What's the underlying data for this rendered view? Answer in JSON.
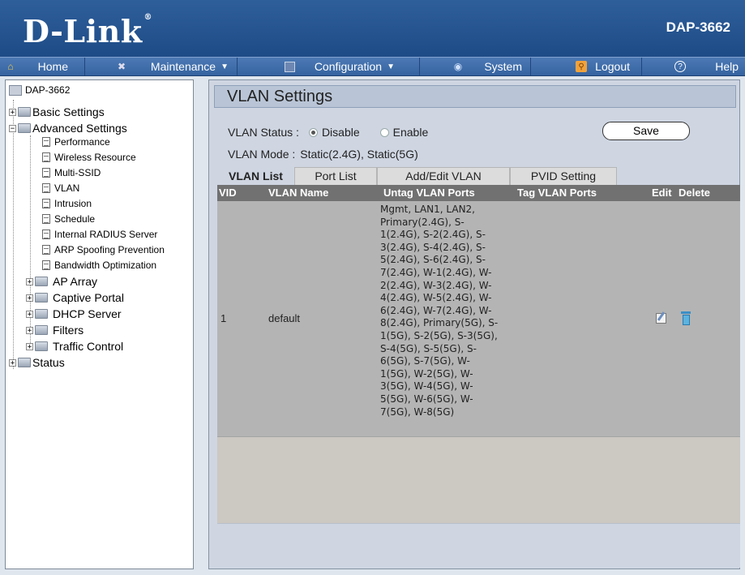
{
  "header": {
    "brand": "D-Link",
    "model": "DAP-3662"
  },
  "menu": [
    {
      "label": "Home",
      "icon": "home-icon",
      "caret": false
    },
    {
      "label": "Maintenance",
      "icon": "tools-icon",
      "caret": true
    },
    {
      "label": "Configuration",
      "icon": "floppy-icon",
      "caret": true
    },
    {
      "label": "System",
      "icon": "system-icon",
      "caret": false
    },
    {
      "label": "Logout",
      "icon": "key-icon",
      "caret": false
    },
    {
      "label": "Help",
      "icon": "help-icon",
      "caret": false
    }
  ],
  "tree": {
    "root": "DAP-3662",
    "items": [
      "Basic Settings",
      "Advanced Settings",
      "Performance",
      "Wireless Resource",
      "Multi-SSID",
      "VLAN",
      "Intrusion",
      "Schedule",
      "Internal RADIUS Server",
      "ARP Spoofing Prevention",
      "Bandwidth Optimization",
      "AP Array",
      "Captive Portal",
      "DHCP Server",
      "Filters",
      "Traffic Control",
      "Status"
    ]
  },
  "page": {
    "title": "VLAN Settings",
    "status_label": "VLAN Status :",
    "status_options": [
      "Disable",
      "Enable"
    ],
    "status_selected": "Disable",
    "mode_label": "VLAN Mode :",
    "mode_value": "Static(2.4G),  Static(5G)",
    "save_label": "Save"
  },
  "tabs": [
    "VLAN List",
    "Port List",
    "Add/Edit VLAN",
    "PVID Setting"
  ],
  "table": {
    "headers": [
      "VID",
      "VLAN Name",
      "Untag VLAN Ports",
      "Tag VLAN Ports",
      "Edit",
      "Delete"
    ],
    "row": {
      "vid": "1",
      "name": "default",
      "untag_lines": [
        "Mgmt, LAN1, LAN2,",
        "Primary(2.4G), S-",
        "1(2.4G), S-2(2.4G), S-",
        "3(2.4G), S-4(2.4G), S-",
        "5(2.4G), S-6(2.4G), S-",
        "7(2.4G), W-1(2.4G), W-",
        "2(2.4G), W-3(2.4G), W-",
        "4(2.4G), W-5(2.4G), W-",
        "6(2.4G), W-7(2.4G), W-",
        "8(2.4G), Primary(5G), S-",
        "1(5G), S-2(5G), S-3(5G),",
        "S-4(5G), S-5(5G), S-",
        "6(5G), S-7(5G), W-",
        "1(5G), W-2(5G), W-",
        "3(5G), W-4(5G), W-",
        "5(5G), W-6(5G), W-",
        "7(5G), W-8(5G)"
      ],
      "tag": ""
    }
  },
  "colors": {
    "header_bg": "#1d4b86",
    "menubar_bg": "#3563a0",
    "content_bg": "#cfd6e2",
    "table_header": "#717171",
    "table_row": "#b4b4b4"
  }
}
